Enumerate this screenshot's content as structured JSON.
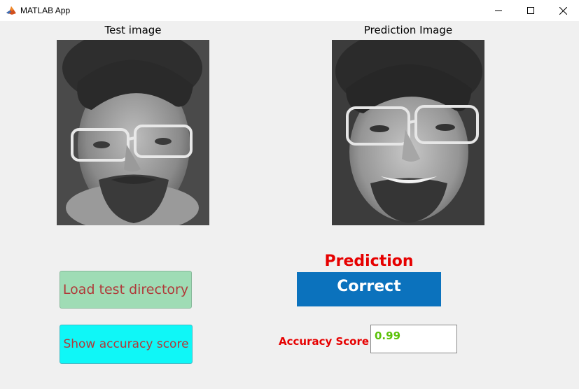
{
  "window": {
    "title": "MATLAB App",
    "minimize_icon": "minimize-icon",
    "maximize_icon": "maximize-icon",
    "close_icon": "close-icon"
  },
  "axes": {
    "test_title": "Test image",
    "prediction_title": "Prediction Image"
  },
  "prediction": {
    "label": "Prediction",
    "result": "Correct",
    "result_bg": "#0b72bd"
  },
  "accuracy": {
    "label": "Accuracy Score",
    "value": "0.99",
    "value_color": "#5cc20a"
  },
  "buttons": {
    "load": "Load test directory",
    "show_accuracy": "Show accuracy score"
  },
  "colors": {
    "label_red": "#e60000",
    "load_button_bg": "#9fdcb5",
    "accuracy_button_bg": "#0ff7f7"
  }
}
